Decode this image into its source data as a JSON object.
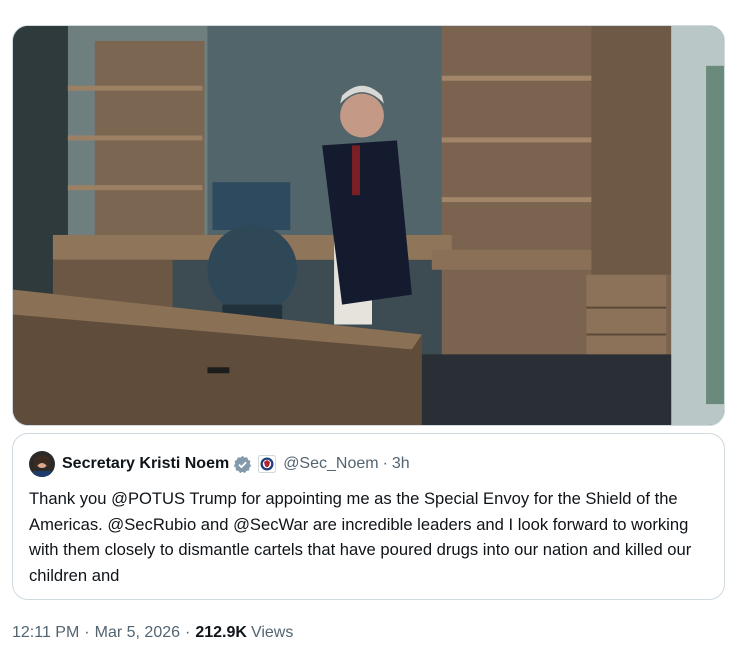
{
  "quoted_tweet": {
    "author_name": "Secretary Kristi Noem",
    "handle": "@Sec_Noem",
    "separator": "·",
    "time_ago": "3h",
    "text": "Thank you @POTUS Trump for appointing me as the Special Envoy for the Shield of the Americas. @SecRubio and @SecWar are incredible leaders and I look forward to working with them closely to dismantle cartels that have poured drugs into our nation and killed our children and",
    "verified_badge": "verified-icon",
    "agency_badge": "dhs-seal-icon"
  },
  "tweet_meta": {
    "time": "12:11 PM",
    "separator": "·",
    "date": "Mar 5, 2026",
    "views_count": "212.9K",
    "views_label": "Views"
  },
  "colors": {
    "text_primary": "#0f1419",
    "text_secondary": "#536471",
    "border": "#cfd9de",
    "verified_blue": "#829aab"
  }
}
